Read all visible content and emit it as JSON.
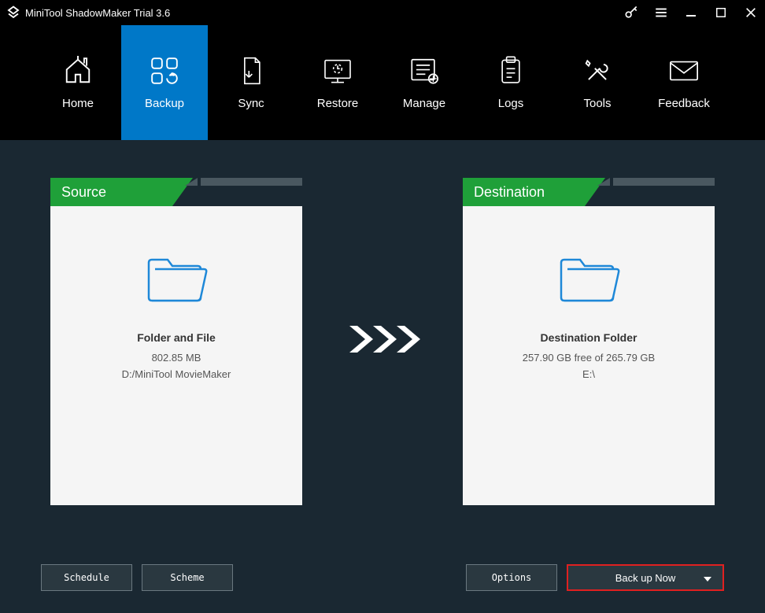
{
  "titlebar": {
    "title": "MiniTool ShadowMaker Trial 3.6"
  },
  "nav": {
    "items": [
      {
        "label": "Home"
      },
      {
        "label": "Backup"
      },
      {
        "label": "Sync"
      },
      {
        "label": "Restore"
      },
      {
        "label": "Manage"
      },
      {
        "label": "Logs"
      },
      {
        "label": "Tools"
      },
      {
        "label": "Feedback"
      }
    ]
  },
  "source": {
    "header": "Source",
    "heading": "Folder and File",
    "size": "802.85 MB",
    "path": "D:/MiniTool MovieMaker"
  },
  "destination": {
    "header": "Destination",
    "heading": "Destination Folder",
    "size": "257.90 GB free of 265.79 GB",
    "path": "E:\\"
  },
  "footer": {
    "schedule": "Schedule",
    "scheme": "Scheme",
    "options": "Options",
    "backup_now": "Back up Now"
  }
}
